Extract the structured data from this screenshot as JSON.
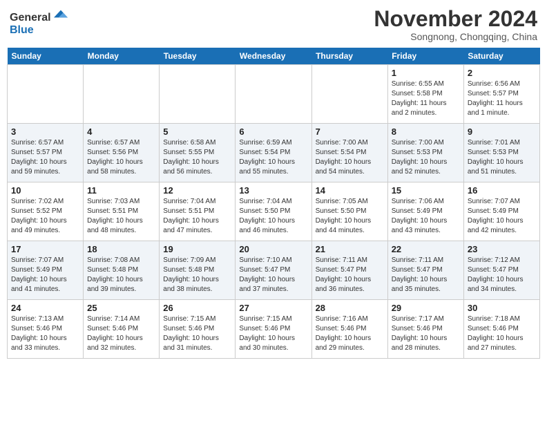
{
  "header": {
    "logo_general": "General",
    "logo_blue": "Blue",
    "month": "November 2024",
    "location": "Songnong, Chongqing, China"
  },
  "days_of_week": [
    "Sunday",
    "Monday",
    "Tuesday",
    "Wednesday",
    "Thursday",
    "Friday",
    "Saturday"
  ],
  "weeks": [
    {
      "alt": false,
      "days": [
        {
          "num": "",
          "info": ""
        },
        {
          "num": "",
          "info": ""
        },
        {
          "num": "",
          "info": ""
        },
        {
          "num": "",
          "info": ""
        },
        {
          "num": "",
          "info": ""
        },
        {
          "num": "1",
          "info": "Sunrise: 6:55 AM\nSunset: 5:58 PM\nDaylight: 11 hours\nand 2 minutes."
        },
        {
          "num": "2",
          "info": "Sunrise: 6:56 AM\nSunset: 5:57 PM\nDaylight: 11 hours\nand 1 minute."
        }
      ]
    },
    {
      "alt": true,
      "days": [
        {
          "num": "3",
          "info": "Sunrise: 6:57 AM\nSunset: 5:57 PM\nDaylight: 10 hours\nand 59 minutes."
        },
        {
          "num": "4",
          "info": "Sunrise: 6:57 AM\nSunset: 5:56 PM\nDaylight: 10 hours\nand 58 minutes."
        },
        {
          "num": "5",
          "info": "Sunrise: 6:58 AM\nSunset: 5:55 PM\nDaylight: 10 hours\nand 56 minutes."
        },
        {
          "num": "6",
          "info": "Sunrise: 6:59 AM\nSunset: 5:54 PM\nDaylight: 10 hours\nand 55 minutes."
        },
        {
          "num": "7",
          "info": "Sunrise: 7:00 AM\nSunset: 5:54 PM\nDaylight: 10 hours\nand 54 minutes."
        },
        {
          "num": "8",
          "info": "Sunrise: 7:00 AM\nSunset: 5:53 PM\nDaylight: 10 hours\nand 52 minutes."
        },
        {
          "num": "9",
          "info": "Sunrise: 7:01 AM\nSunset: 5:53 PM\nDaylight: 10 hours\nand 51 minutes."
        }
      ]
    },
    {
      "alt": false,
      "days": [
        {
          "num": "10",
          "info": "Sunrise: 7:02 AM\nSunset: 5:52 PM\nDaylight: 10 hours\nand 49 minutes."
        },
        {
          "num": "11",
          "info": "Sunrise: 7:03 AM\nSunset: 5:51 PM\nDaylight: 10 hours\nand 48 minutes."
        },
        {
          "num": "12",
          "info": "Sunrise: 7:04 AM\nSunset: 5:51 PM\nDaylight: 10 hours\nand 47 minutes."
        },
        {
          "num": "13",
          "info": "Sunrise: 7:04 AM\nSunset: 5:50 PM\nDaylight: 10 hours\nand 46 minutes."
        },
        {
          "num": "14",
          "info": "Sunrise: 7:05 AM\nSunset: 5:50 PM\nDaylight: 10 hours\nand 44 minutes."
        },
        {
          "num": "15",
          "info": "Sunrise: 7:06 AM\nSunset: 5:49 PM\nDaylight: 10 hours\nand 43 minutes."
        },
        {
          "num": "16",
          "info": "Sunrise: 7:07 AM\nSunset: 5:49 PM\nDaylight: 10 hours\nand 42 minutes."
        }
      ]
    },
    {
      "alt": true,
      "days": [
        {
          "num": "17",
          "info": "Sunrise: 7:07 AM\nSunset: 5:49 PM\nDaylight: 10 hours\nand 41 minutes."
        },
        {
          "num": "18",
          "info": "Sunrise: 7:08 AM\nSunset: 5:48 PM\nDaylight: 10 hours\nand 39 minutes."
        },
        {
          "num": "19",
          "info": "Sunrise: 7:09 AM\nSunset: 5:48 PM\nDaylight: 10 hours\nand 38 minutes."
        },
        {
          "num": "20",
          "info": "Sunrise: 7:10 AM\nSunset: 5:47 PM\nDaylight: 10 hours\nand 37 minutes."
        },
        {
          "num": "21",
          "info": "Sunrise: 7:11 AM\nSunset: 5:47 PM\nDaylight: 10 hours\nand 36 minutes."
        },
        {
          "num": "22",
          "info": "Sunrise: 7:11 AM\nSunset: 5:47 PM\nDaylight: 10 hours\nand 35 minutes."
        },
        {
          "num": "23",
          "info": "Sunrise: 7:12 AM\nSunset: 5:47 PM\nDaylight: 10 hours\nand 34 minutes."
        }
      ]
    },
    {
      "alt": false,
      "days": [
        {
          "num": "24",
          "info": "Sunrise: 7:13 AM\nSunset: 5:46 PM\nDaylight: 10 hours\nand 33 minutes."
        },
        {
          "num": "25",
          "info": "Sunrise: 7:14 AM\nSunset: 5:46 PM\nDaylight: 10 hours\nand 32 minutes."
        },
        {
          "num": "26",
          "info": "Sunrise: 7:15 AM\nSunset: 5:46 PM\nDaylight: 10 hours\nand 31 minutes."
        },
        {
          "num": "27",
          "info": "Sunrise: 7:15 AM\nSunset: 5:46 PM\nDaylight: 10 hours\nand 30 minutes."
        },
        {
          "num": "28",
          "info": "Sunrise: 7:16 AM\nSunset: 5:46 PM\nDaylight: 10 hours\nand 29 minutes."
        },
        {
          "num": "29",
          "info": "Sunrise: 7:17 AM\nSunset: 5:46 PM\nDaylight: 10 hours\nand 28 minutes."
        },
        {
          "num": "30",
          "info": "Sunrise: 7:18 AM\nSunset: 5:46 PM\nDaylight: 10 hours\nand 27 minutes."
        }
      ]
    }
  ]
}
